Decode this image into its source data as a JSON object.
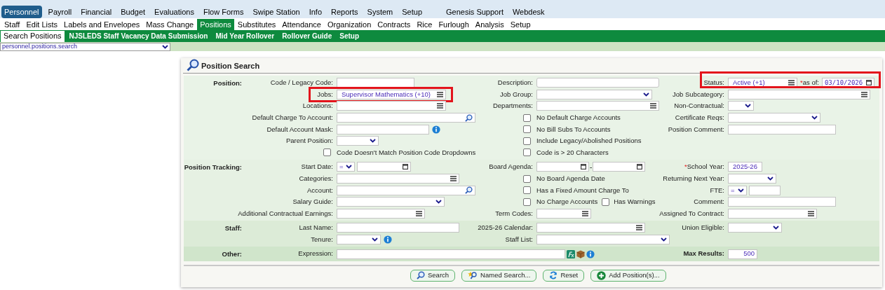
{
  "main_menu": {
    "left": [
      {
        "label": "Personnel",
        "selected": true
      },
      {
        "label": "Payroll",
        "selected": false
      },
      {
        "label": "Financial",
        "selected": false
      },
      {
        "label": "Budget",
        "selected": false
      },
      {
        "label": "Evaluations",
        "selected": false
      },
      {
        "label": "Flow Forms",
        "selected": false
      },
      {
        "label": "Swipe Station",
        "selected": false
      },
      {
        "label": "Info",
        "selected": false
      },
      {
        "label": "Reports",
        "selected": false
      },
      {
        "label": "System",
        "selected": false
      },
      {
        "label": "Setup",
        "selected": false
      }
    ],
    "right": [
      {
        "label": "Genesis Support",
        "selected": false
      },
      {
        "label": "Webdesk",
        "selected": false
      }
    ]
  },
  "sub_menu": [
    {
      "label": "Staff",
      "selected": false
    },
    {
      "label": "Edit Lists",
      "selected": false
    },
    {
      "label": "Labels and Envelopes",
      "selected": false
    },
    {
      "label": "Mass Change",
      "selected": false
    },
    {
      "label": "Positions",
      "selected": true
    },
    {
      "label": "Substitutes",
      "selected": false
    },
    {
      "label": "Attendance",
      "selected": false
    },
    {
      "label": "Organization",
      "selected": false
    },
    {
      "label": "Contracts",
      "selected": false
    },
    {
      "label": "Rice",
      "selected": false
    },
    {
      "label": "Furlough",
      "selected": false
    },
    {
      "label": "Analysis",
      "selected": false
    },
    {
      "label": "Setup",
      "selected": false
    }
  ],
  "page_menu": [
    {
      "label": "Search Positions",
      "selected": true
    },
    {
      "label": "NJSLEDS Staff Vacancy Data Submission",
      "selected": false
    },
    {
      "label": "Mid Year Rollover",
      "selected": false
    },
    {
      "label": "Rollover Guide",
      "selected": false
    },
    {
      "label": "Setup",
      "selected": false
    }
  ],
  "path_select": {
    "value": "personnel.positions.search"
  },
  "panel": {
    "title": "Position Search"
  },
  "sections": [
    {
      "label": "Position:",
      "rows": [
        {
          "cells": [
            {
              "kind": "input",
              "label": "Code / Legacy Code:"
            },
            {
              "kind": "input",
              "label": "Description:",
              "focused": true
            },
            {
              "kind": "status",
              "label": "Status:",
              "value": "Active (+1)",
              "date_required_mark": "*",
              "date_label": "as of:",
              "date_value": "03/10/2026",
              "highlighted": true
            }
          ]
        },
        {
          "cells": [
            {
              "kind": "multi",
              "label": "Jobs:",
              "value": "Supervisor Mathematics (+10)",
              "highlighted": true
            },
            {
              "kind": "select",
              "label": "Job Group:"
            },
            {
              "kind": "multi",
              "label": "Job Subcategory:"
            }
          ]
        },
        {
          "cells": [
            {
              "kind": "multi",
              "label": "Locations:"
            },
            {
              "kind": "multi",
              "label": "Departments:"
            },
            {
              "kind": "select",
              "label": "Non-Contractual:"
            }
          ]
        },
        {
          "cells": [
            {
              "kind": "lookup",
              "label": "Default Charge To Account:"
            },
            {
              "kind": "checkbox",
              "label": "No Default Charge Accounts",
              "checked": false
            },
            {
              "kind": "select",
              "label": "Certificate Reqs:"
            }
          ]
        },
        {
          "cells": [
            {
              "kind": "input",
              "label": "Default Account Mask:",
              "info": true
            },
            {
              "kind": "checkbox",
              "label": "No Bill Subs To Accounts",
              "checked": false
            },
            {
              "kind": "input",
              "label": "Position Comment:"
            }
          ]
        },
        {
          "cells": [
            {
              "kind": "select",
              "label": "Parent Position:"
            },
            {
              "kind": "checkbox",
              "label": "Include Legacy/Abolished Positions",
              "checked": false
            },
            null
          ]
        },
        {
          "cells": [
            {
              "kind": "checkbox",
              "label": "Code Doesn't Match Position Code Dropdowns",
              "checked": false
            },
            {
              "kind": "checkbox",
              "label": "Code is > 20 Characters",
              "checked": false
            },
            null
          ]
        }
      ]
    },
    {
      "label": "Position Tracking:",
      "rows": [
        {
          "cells": [
            {
              "kind": "date",
              "label": "Start Date:",
              "op": "="
            },
            {
              "kind": "daterange",
              "label": "Board Agenda:",
              "separator": "-"
            },
            {
              "kind": "readonly",
              "label": "School Year:",
              "required_mark": "*",
              "value": "2025-26"
            }
          ]
        },
        {
          "cells": [
            {
              "kind": "multi",
              "label": "Categories:"
            },
            {
              "kind": "checkbox",
              "label": "No Board Agenda Date",
              "checked": false
            },
            {
              "kind": "select",
              "label": "Returning Next Year:"
            }
          ]
        },
        {
          "cells": [
            {
              "kind": "lookup",
              "label": "Account:"
            },
            {
              "kind": "checkbox",
              "label": "Has a Fixed Amount Charge To",
              "checked": false
            },
            {
              "kind": "opinput",
              "label": "FTE:",
              "op": "="
            }
          ]
        },
        {
          "cells": [
            {
              "kind": "select",
              "label": "Salary Guide:"
            },
            {
              "kind": "checkboxes",
              "items": [
                {
                  "label": "No Charge Accounts",
                  "checked": false
                },
                {
                  "label": "Has Warnings",
                  "checked": false
                }
              ]
            },
            {
              "kind": "input",
              "label": "Comment:"
            }
          ]
        },
        {
          "cells": [
            {
              "kind": "multi",
              "label": "Additional Contractual Earnings:"
            },
            {
              "kind": "multi",
              "label": "Term Codes:"
            },
            {
              "kind": "multi",
              "label": "Assigned To Contract:"
            }
          ]
        }
      ]
    },
    {
      "label": "Staff:",
      "rows": [
        {
          "cells": [
            {
              "kind": "input",
              "label": "Last Name:"
            },
            {
              "kind": "multi",
              "label": "2025-26 Calendar:"
            },
            {
              "kind": "select",
              "label": "Union Eligible:"
            }
          ]
        },
        {
          "cells": [
            {
              "kind": "select",
              "label": "Tenure:",
              "info": true
            },
            {
              "kind": "select",
              "label": "Staff List:"
            },
            null
          ]
        }
      ]
    },
    {
      "label": "Other:",
      "rows": [
        {
          "cells": [
            {
              "kind": "expression",
              "label": "Expression:"
            },
            null,
            {
              "kind": "count",
              "label": "Max Results:",
              "value": "500"
            }
          ]
        }
      ]
    }
  ],
  "buttons": [
    {
      "kind": "search",
      "label": "Search"
    },
    {
      "kind": "named",
      "label": "Named Search..."
    },
    {
      "kind": "reset",
      "label": "Reset"
    },
    {
      "kind": "add",
      "label": "Add Position(s)..."
    }
  ]
}
